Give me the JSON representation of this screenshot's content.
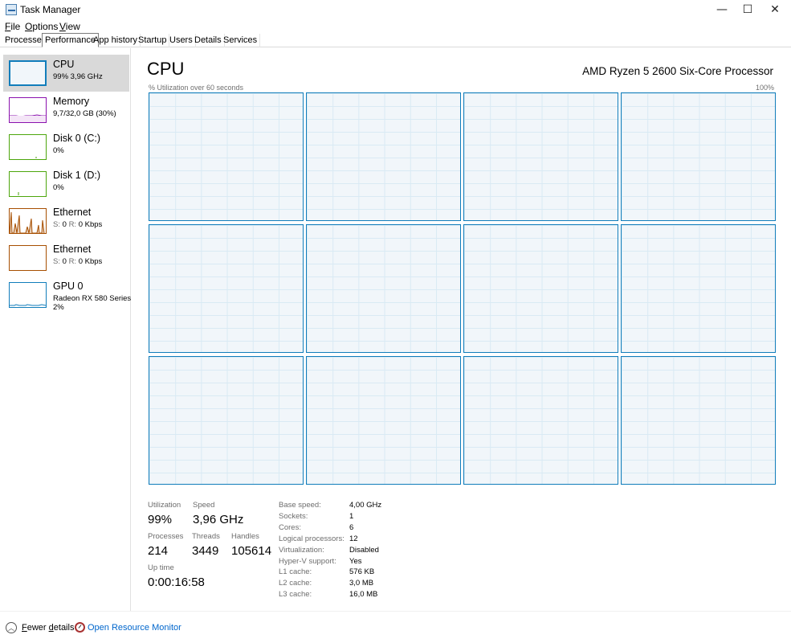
{
  "window": {
    "title": "Task Manager",
    "minimize": "—",
    "maximize": "☐",
    "close": "✕"
  },
  "menu": [
    {
      "label": "File",
      "key": "F",
      "rest": "ile"
    },
    {
      "label": "Options",
      "key": "O",
      "rest": "ptions"
    },
    {
      "label": "View",
      "key": "V",
      "rest": "iew"
    }
  ],
  "tabs": [
    "Processes",
    "Performance",
    "App history",
    "Startup",
    "Users",
    "Details",
    "Services"
  ],
  "active_tab": "Performance",
  "sidebar": [
    {
      "name": "CPU",
      "sub": "99%  3,96 GHz",
      "color": "#117dbb"
    },
    {
      "name": "Memory",
      "sub": "9,7/32,0 GB (30%)",
      "color": "#8b12ae"
    },
    {
      "name": "Disk 0 (C:)",
      "sub": "0%",
      "color": "#4da60c"
    },
    {
      "name": "Disk 1 (D:)",
      "sub": "0%",
      "color": "#4da60c"
    },
    {
      "name": "Ethernet",
      "sub_s": "S:",
      "sub_s_val": "0",
      "sub_r": "R:",
      "sub_r_val": "0 Kbps",
      "color": "#a74f01"
    },
    {
      "name": "Ethernet",
      "sub_s": "S:",
      "sub_s_val": "0",
      "sub_r": "R:",
      "sub_r_val": "0 Kbps",
      "color": "#a74f01"
    },
    {
      "name": "GPU 0",
      "sub": "Radeon RX 580 Series",
      "sub2": "2%",
      "color": "#117dbb"
    }
  ],
  "main": {
    "title": "CPU",
    "model": "AMD Ryzen 5 2600 Six-Core Processor",
    "util_caption": "% Utilization over 60 seconds",
    "util_max": "100%",
    "core_count": 12
  },
  "stats": {
    "utilization_label": "Utilization",
    "utilization": "99%",
    "speed_label": "Speed",
    "speed": "3,96 GHz",
    "processes_label": "Processes",
    "processes": "214",
    "threads_label": "Threads",
    "threads": "3449",
    "handles_label": "Handles",
    "handles": "105614",
    "uptime_label": "Up time",
    "uptime": "0:00:16:58"
  },
  "specs": [
    {
      "label": "Base speed:",
      "value": "4,00 GHz"
    },
    {
      "label": "Sockets:",
      "value": "1"
    },
    {
      "label": "Cores:",
      "value": "6"
    },
    {
      "label": "Logical processors:",
      "value": "12"
    },
    {
      "label": "Virtualization:",
      "value": "Disabled"
    },
    {
      "label": "Hyper-V support:",
      "value": "Yes"
    },
    {
      "label": "L1 cache:",
      "value": "576 KB"
    },
    {
      "label": "L2 cache:",
      "value": "3,0 MB"
    },
    {
      "label": "L3 cache:",
      "value": "16,0 MB"
    }
  ],
  "footer": {
    "fewer_details_key": "F",
    "fewer_details_rest": "ewer ",
    "fewer_details_key2": "d",
    "fewer_details_rest2": "etails",
    "open_resource_monitor": "Open Resource Monitor"
  }
}
